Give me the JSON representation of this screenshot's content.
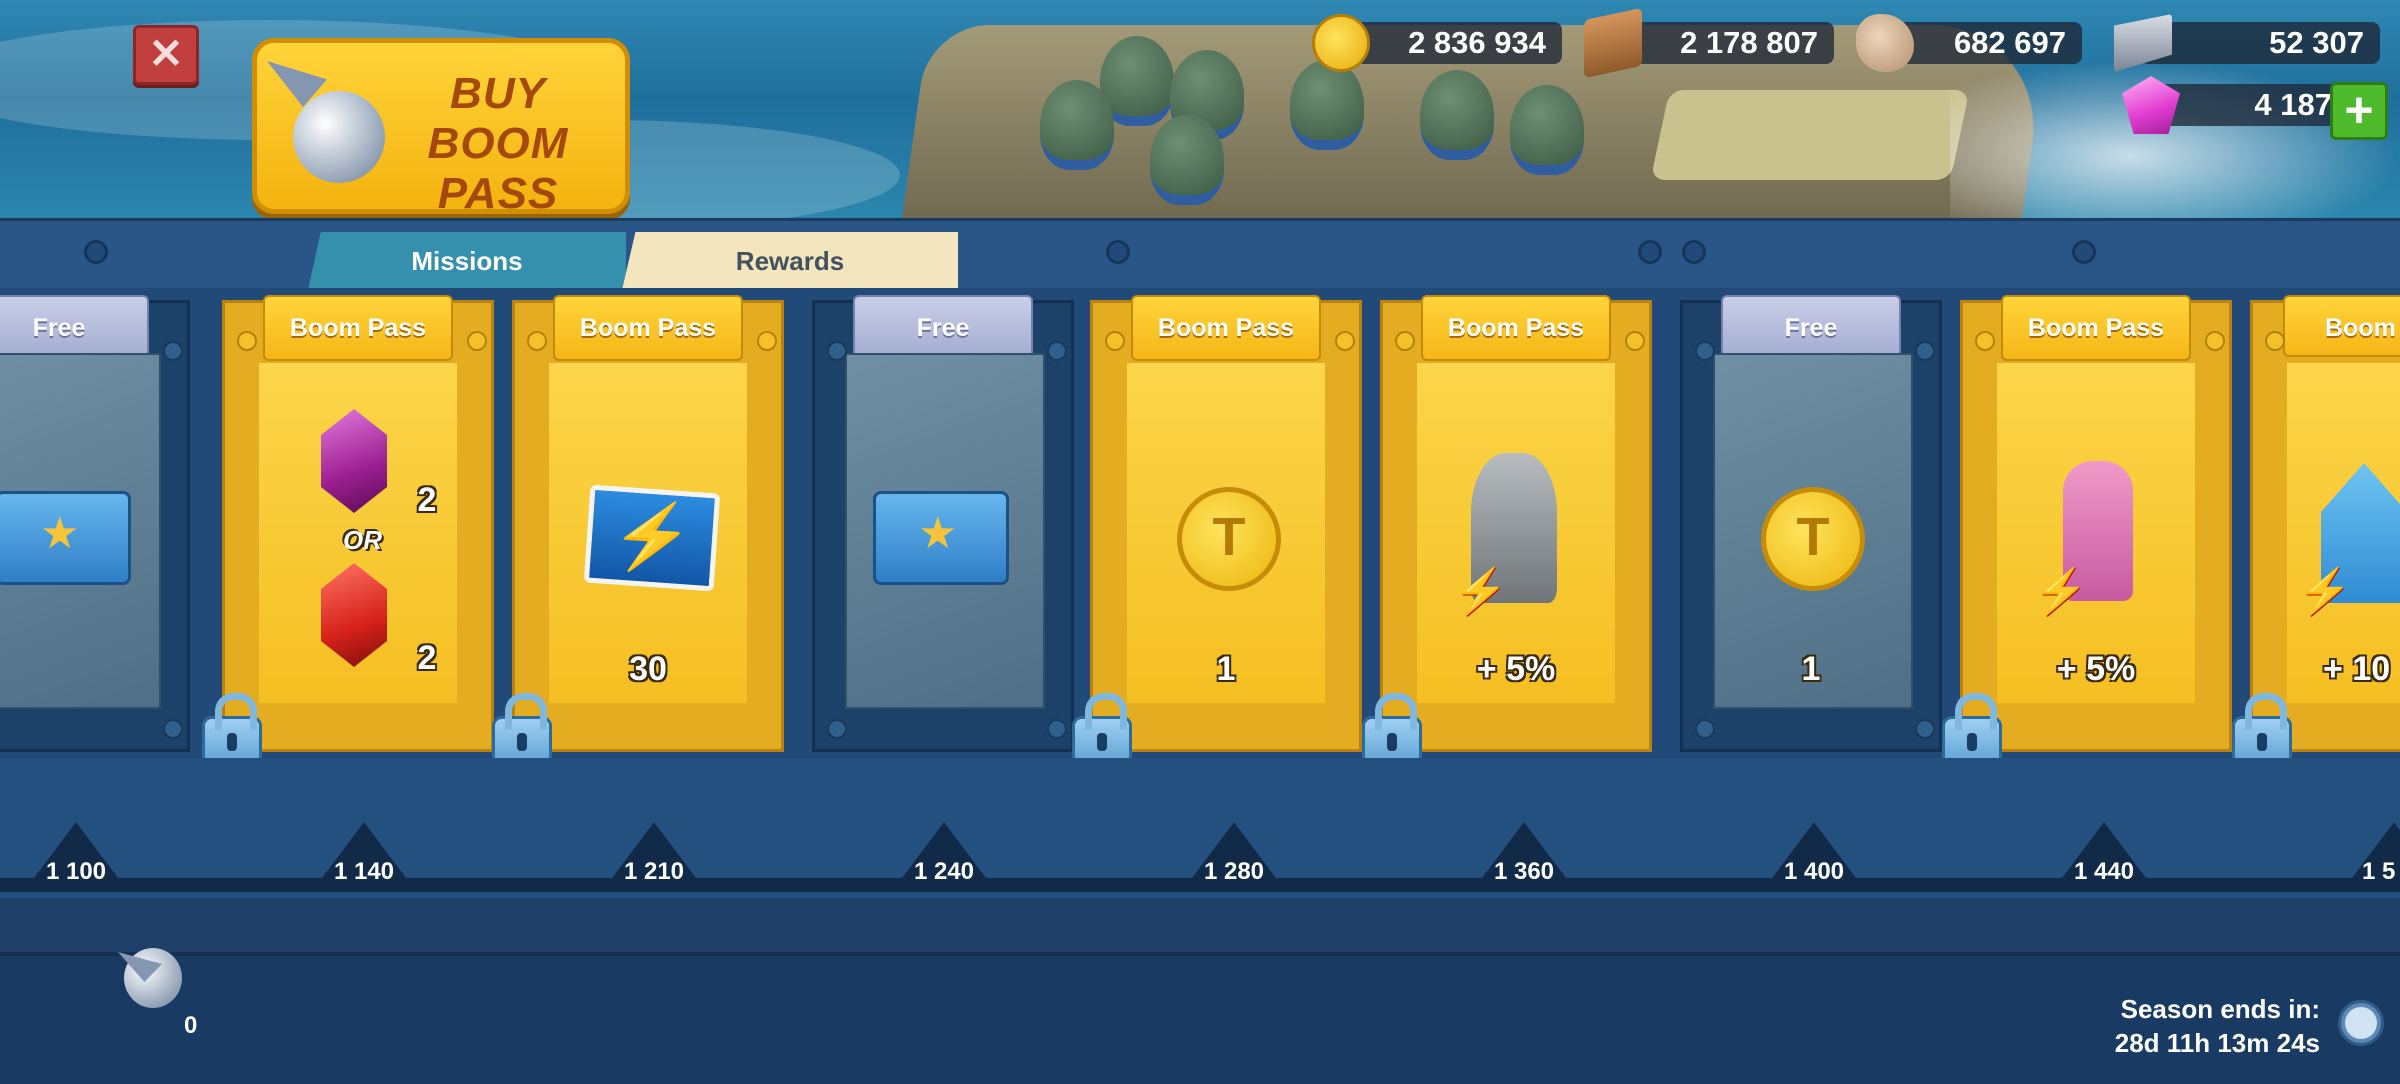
{
  "header": {
    "close_icon": "close-icon",
    "buy_button_label": "BUY BOOM\nPASS"
  },
  "resources": {
    "gold": "2 836 934",
    "wood": "2 178 807",
    "stone": "682 697",
    "iron": "52 307",
    "diamonds": "4 187",
    "add_icon": "+"
  },
  "tabs": {
    "missions": "Missions",
    "rewards": "Rewards"
  },
  "rewards": [
    {
      "tier": "Free",
      "reward": "chest-icon",
      "qty": ""
    },
    {
      "tier": "Boom Pass",
      "reward": "crystal-choice",
      "qty_a": "2",
      "or_label": "OR",
      "qty_b": "2"
    },
    {
      "tier": "Boom Pass",
      "reward": "energy-icon",
      "qty": "30"
    },
    {
      "tier": "Free",
      "reward": "chest-icon",
      "qty": ""
    },
    {
      "tier": "Boom Pass",
      "reward": "builder-coin-icon",
      "qty": "1"
    },
    {
      "tier": "Boom Pass",
      "reward": "statue-boost-icon",
      "qty": "+ 5%"
    },
    {
      "tier": "Free",
      "reward": "builder-coin-icon",
      "qty": "1"
    },
    {
      "tier": "Boom Pass",
      "reward": "research-boost-icon",
      "qty": "+ 5%"
    },
    {
      "tier": "Boom",
      "reward": "building-boost-icon",
      "qty": "+ 10"
    }
  ],
  "milestones": [
    "1 100",
    "1 140",
    "1 210",
    "1 240",
    "1 280",
    "1 360",
    "1 400",
    "1 440",
    "1 5"
  ],
  "footer": {
    "token_count": "0",
    "season_label": "Season ends in:",
    "season_time": "28d 11h 13m 24s"
  }
}
